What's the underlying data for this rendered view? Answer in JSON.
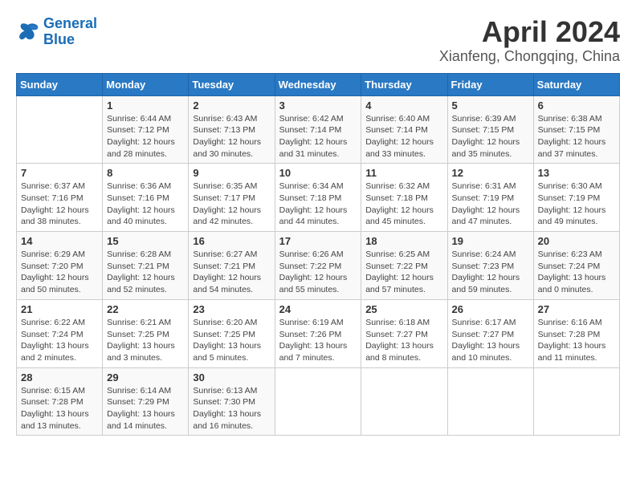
{
  "header": {
    "logo_line1": "General",
    "logo_line2": "Blue",
    "title": "April 2024",
    "subtitle": "Xianfeng, Chongqing, China"
  },
  "calendar": {
    "weekdays": [
      "Sunday",
      "Monday",
      "Tuesday",
      "Wednesday",
      "Thursday",
      "Friday",
      "Saturday"
    ],
    "weeks": [
      [
        {
          "day": "",
          "info": ""
        },
        {
          "day": "1",
          "info": "Sunrise: 6:44 AM\nSunset: 7:12 PM\nDaylight: 12 hours\nand 28 minutes."
        },
        {
          "day": "2",
          "info": "Sunrise: 6:43 AM\nSunset: 7:13 PM\nDaylight: 12 hours\nand 30 minutes."
        },
        {
          "day": "3",
          "info": "Sunrise: 6:42 AM\nSunset: 7:14 PM\nDaylight: 12 hours\nand 31 minutes."
        },
        {
          "day": "4",
          "info": "Sunrise: 6:40 AM\nSunset: 7:14 PM\nDaylight: 12 hours\nand 33 minutes."
        },
        {
          "day": "5",
          "info": "Sunrise: 6:39 AM\nSunset: 7:15 PM\nDaylight: 12 hours\nand 35 minutes."
        },
        {
          "day": "6",
          "info": "Sunrise: 6:38 AM\nSunset: 7:15 PM\nDaylight: 12 hours\nand 37 minutes."
        }
      ],
      [
        {
          "day": "7",
          "info": "Sunrise: 6:37 AM\nSunset: 7:16 PM\nDaylight: 12 hours\nand 38 minutes."
        },
        {
          "day": "8",
          "info": "Sunrise: 6:36 AM\nSunset: 7:16 PM\nDaylight: 12 hours\nand 40 minutes."
        },
        {
          "day": "9",
          "info": "Sunrise: 6:35 AM\nSunset: 7:17 PM\nDaylight: 12 hours\nand 42 minutes."
        },
        {
          "day": "10",
          "info": "Sunrise: 6:34 AM\nSunset: 7:18 PM\nDaylight: 12 hours\nand 44 minutes."
        },
        {
          "day": "11",
          "info": "Sunrise: 6:32 AM\nSunset: 7:18 PM\nDaylight: 12 hours\nand 45 minutes."
        },
        {
          "day": "12",
          "info": "Sunrise: 6:31 AM\nSunset: 7:19 PM\nDaylight: 12 hours\nand 47 minutes."
        },
        {
          "day": "13",
          "info": "Sunrise: 6:30 AM\nSunset: 7:19 PM\nDaylight: 12 hours\nand 49 minutes."
        }
      ],
      [
        {
          "day": "14",
          "info": "Sunrise: 6:29 AM\nSunset: 7:20 PM\nDaylight: 12 hours\nand 50 minutes."
        },
        {
          "day": "15",
          "info": "Sunrise: 6:28 AM\nSunset: 7:21 PM\nDaylight: 12 hours\nand 52 minutes."
        },
        {
          "day": "16",
          "info": "Sunrise: 6:27 AM\nSunset: 7:21 PM\nDaylight: 12 hours\nand 54 minutes."
        },
        {
          "day": "17",
          "info": "Sunrise: 6:26 AM\nSunset: 7:22 PM\nDaylight: 12 hours\nand 55 minutes."
        },
        {
          "day": "18",
          "info": "Sunrise: 6:25 AM\nSunset: 7:22 PM\nDaylight: 12 hours\nand 57 minutes."
        },
        {
          "day": "19",
          "info": "Sunrise: 6:24 AM\nSunset: 7:23 PM\nDaylight: 12 hours\nand 59 minutes."
        },
        {
          "day": "20",
          "info": "Sunrise: 6:23 AM\nSunset: 7:24 PM\nDaylight: 13 hours\nand 0 minutes."
        }
      ],
      [
        {
          "day": "21",
          "info": "Sunrise: 6:22 AM\nSunset: 7:24 PM\nDaylight: 13 hours\nand 2 minutes."
        },
        {
          "day": "22",
          "info": "Sunrise: 6:21 AM\nSunset: 7:25 PM\nDaylight: 13 hours\nand 3 minutes."
        },
        {
          "day": "23",
          "info": "Sunrise: 6:20 AM\nSunset: 7:25 PM\nDaylight: 13 hours\nand 5 minutes."
        },
        {
          "day": "24",
          "info": "Sunrise: 6:19 AM\nSunset: 7:26 PM\nDaylight: 13 hours\nand 7 minutes."
        },
        {
          "day": "25",
          "info": "Sunrise: 6:18 AM\nSunset: 7:27 PM\nDaylight: 13 hours\nand 8 minutes."
        },
        {
          "day": "26",
          "info": "Sunrise: 6:17 AM\nSunset: 7:27 PM\nDaylight: 13 hours\nand 10 minutes."
        },
        {
          "day": "27",
          "info": "Sunrise: 6:16 AM\nSunset: 7:28 PM\nDaylight: 13 hours\nand 11 minutes."
        }
      ],
      [
        {
          "day": "28",
          "info": "Sunrise: 6:15 AM\nSunset: 7:28 PM\nDaylight: 13 hours\nand 13 minutes."
        },
        {
          "day": "29",
          "info": "Sunrise: 6:14 AM\nSunset: 7:29 PM\nDaylight: 13 hours\nand 14 minutes."
        },
        {
          "day": "30",
          "info": "Sunrise: 6:13 AM\nSunset: 7:30 PM\nDaylight: 13 hours\nand 16 minutes."
        },
        {
          "day": "",
          "info": ""
        },
        {
          "day": "",
          "info": ""
        },
        {
          "day": "",
          "info": ""
        },
        {
          "day": "",
          "info": ""
        }
      ]
    ]
  }
}
